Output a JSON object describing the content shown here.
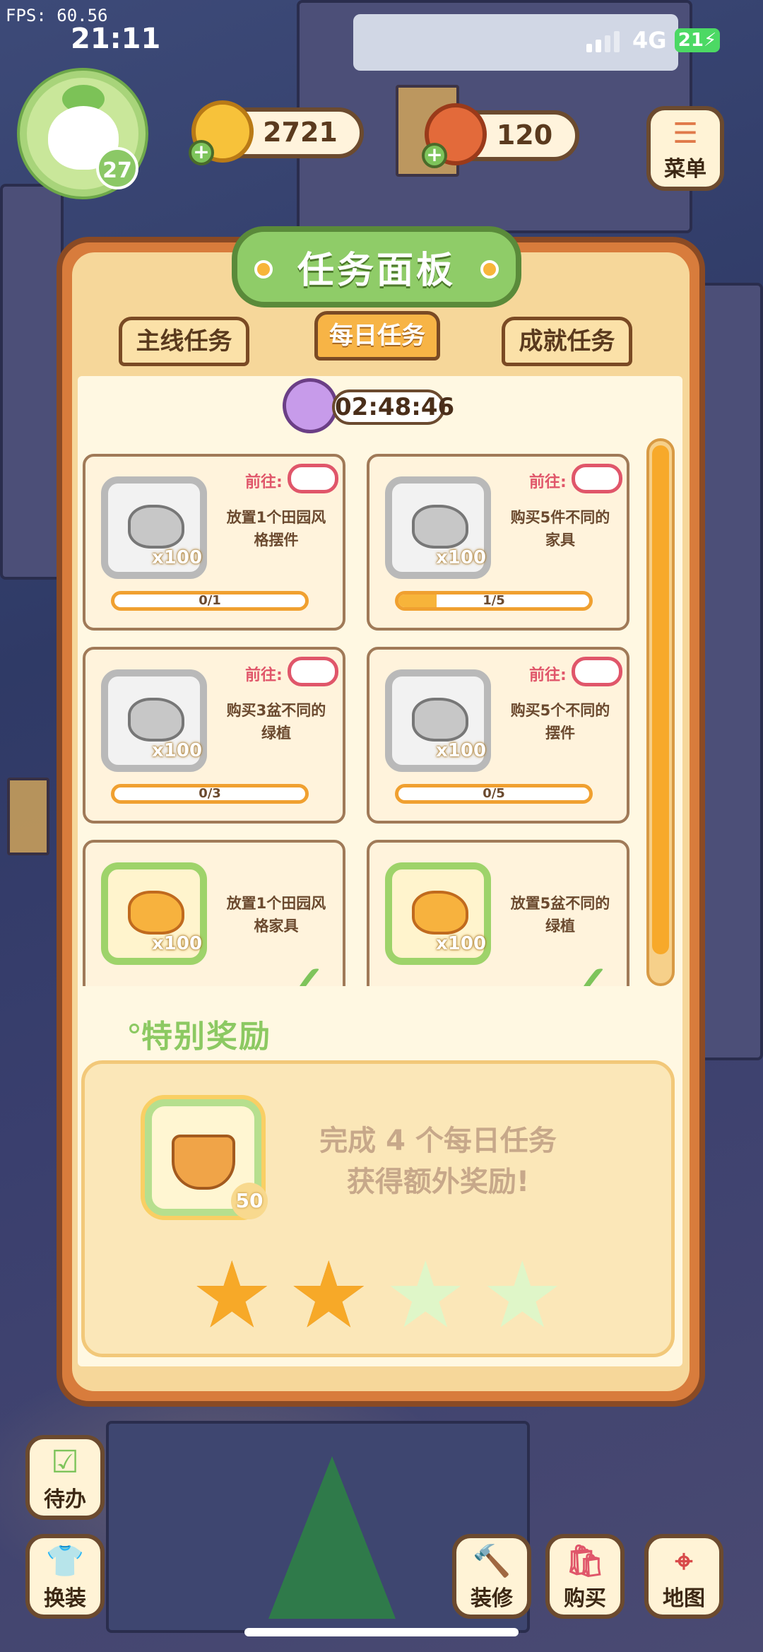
{
  "status": {
    "fps": "FPS: 60.56",
    "time": "21:11",
    "network": "4G",
    "battery": "21"
  },
  "player": {
    "level": "27"
  },
  "resources": [
    {
      "name": "coin",
      "value": "2721"
    },
    {
      "name": "carrot",
      "value": "120"
    }
  ],
  "side_buttons": [
    {
      "label": "菜单",
      "icon": "menu-icon"
    }
  ],
  "panel": {
    "title": "任务面板",
    "tabs": [
      {
        "label": "主线任务",
        "active": false
      },
      {
        "label": "每日任务",
        "active": true
      },
      {
        "label": "成就任务",
        "active": false
      }
    ],
    "timer": "02:48:46",
    "tasks": [
      {
        "go": "前往:",
        "desc": "放置1个田园风格摆件",
        "qty": "x100",
        "progress": "0/1",
        "fraction": 0,
        "done": false
      },
      {
        "go": "前往:",
        "desc": "购买5件不同的家具",
        "qty": "x100",
        "progress": "1/5",
        "fraction": 0.2,
        "done": false
      },
      {
        "go": "前往:",
        "desc": "购买3盆不同的绿植",
        "qty": "x100",
        "progress": "0/3",
        "fraction": 0,
        "done": false
      },
      {
        "go": "前往:",
        "desc": "购买5个不同的摆件",
        "qty": "x100",
        "progress": "0/5",
        "fraction": 0,
        "done": false
      },
      {
        "go": "",
        "desc": "放置1个田园风格家具",
        "qty": "x100",
        "progress": "",
        "fraction": 1,
        "done": true
      },
      {
        "go": "",
        "desc": "放置5盆不同的绿植",
        "qty": "x100",
        "progress": "",
        "fraction": 1,
        "done": true
      }
    ],
    "special": {
      "title": "特别奖励",
      "line1": "完成 4 个每日任务",
      "line2": "获得额外奖励!",
      "reward_qty": "50",
      "stars_total": 4,
      "stars_earned": 2
    }
  },
  "bottom_buttons": [
    {
      "label": "待办",
      "icon": "todo-icon"
    },
    {
      "label": "换装",
      "icon": "outfit-icon"
    },
    {
      "label": "装修",
      "icon": "decorate-icon"
    },
    {
      "label": "购买",
      "icon": "shop-icon"
    },
    {
      "label": "地图",
      "icon": "map-icon"
    }
  ],
  "colors": {
    "panel_border": "#8a4a24",
    "title_green": "#8fcc68",
    "star_on": "#f7a928",
    "star_off": "#dff6c8"
  }
}
